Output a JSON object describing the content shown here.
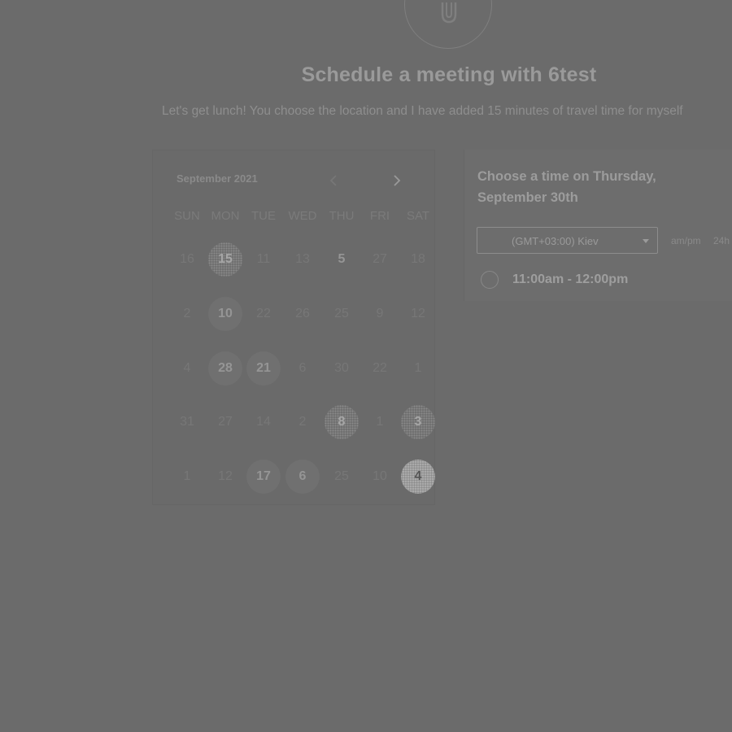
{
  "header": {
    "title": "Schedule a meeting with 6test",
    "subtitle": "Let's get lunch! You choose the location and I have added 15 minutes of travel time for myself"
  },
  "calendar": {
    "month_label": "September 2021",
    "prev_icon": "chevron-left-icon",
    "next_icon": "chevron-right-icon",
    "weekdays": [
      "SUN",
      "MON",
      "TUE",
      "WED",
      "THU",
      "FRI",
      "SAT"
    ],
    "weeks": [
      [
        {
          "label": "16",
          "state": "disabled"
        },
        {
          "label": "15",
          "state": "dotted"
        },
        {
          "label": "11",
          "state": "disabled"
        },
        {
          "label": "13",
          "state": "disabled"
        },
        {
          "label": "5",
          "state": "plain-bold"
        },
        {
          "label": "27",
          "state": "disabled"
        },
        {
          "label": "18",
          "state": "disabled"
        }
      ],
      [
        {
          "label": "2",
          "state": "disabled"
        },
        {
          "label": "10",
          "state": "avail"
        },
        {
          "label": "22",
          "state": "disabled"
        },
        {
          "label": "26",
          "state": "disabled"
        },
        {
          "label": "25",
          "state": "disabled"
        },
        {
          "label": "9",
          "state": "disabled"
        },
        {
          "label": "12",
          "state": "disabled"
        }
      ],
      [
        {
          "label": "4",
          "state": "disabled"
        },
        {
          "label": "28",
          "state": "avail"
        },
        {
          "label": "21",
          "state": "avail"
        },
        {
          "label": "6",
          "state": "disabled"
        },
        {
          "label": "30",
          "state": "disabled"
        },
        {
          "label": "22",
          "state": "disabled"
        },
        {
          "label": "1",
          "state": "disabled"
        }
      ],
      [
        {
          "label": "31",
          "state": "disabled"
        },
        {
          "label": "27",
          "state": "disabled"
        },
        {
          "label": "14",
          "state": "disabled"
        },
        {
          "label": "2",
          "state": "disabled"
        },
        {
          "label": "8",
          "state": "dotted"
        },
        {
          "label": "1",
          "state": "disabled"
        },
        {
          "label": "3",
          "state": "dotted"
        }
      ],
      [
        {
          "label": "1",
          "state": "disabled"
        },
        {
          "label": "12",
          "state": "disabled"
        },
        {
          "label": "17",
          "state": "avail"
        },
        {
          "label": "6",
          "state": "avail"
        },
        {
          "label": "25",
          "state": "disabled"
        },
        {
          "label": "10",
          "state": "disabled"
        },
        {
          "label": "4",
          "state": "selected"
        }
      ]
    ]
  },
  "time_picker": {
    "heading": "Choose a time on Thursday, September 30th",
    "timezone": "(GMT+03:00) Kiev",
    "format_ampm": "am/pm",
    "format_24h": "24h",
    "slots": [
      "11:00am - 12:00pm"
    ]
  },
  "colors": {
    "overlay": "#6b6b6b",
    "selected_day": "#b1b1b1",
    "available_day": "#707070"
  }
}
